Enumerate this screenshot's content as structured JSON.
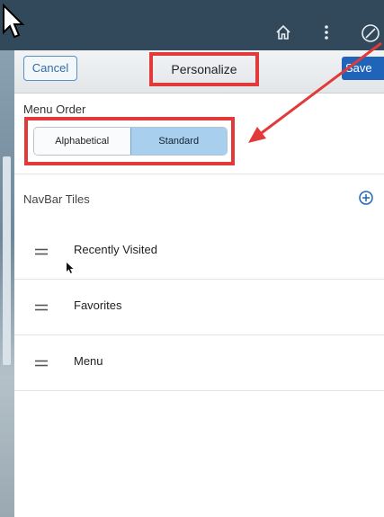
{
  "header": {
    "cancel_label": "Cancel",
    "title": "Personalize",
    "save_label": "Save"
  },
  "menu_order": {
    "label": "Menu Order",
    "options": [
      "Alphabetical",
      "Standard"
    ],
    "selected": "Standard"
  },
  "navbar_tiles": {
    "label": "NavBar Tiles",
    "items": [
      {
        "label": "Recently Visited",
        "icon": "drag-handle-icon"
      },
      {
        "label": "Favorites",
        "icon": "drag-handle-icon"
      },
      {
        "label": "Menu",
        "icon": "drag-handle-icon"
      }
    ]
  },
  "topbar_icons": [
    "home-icon",
    "more-vertical-icon",
    "nav-compass-icon"
  ],
  "colors": {
    "highlight": "#e23a3a",
    "accent": "#1f64b8",
    "selected_segment": "#a8cfee",
    "topbar": "#31495a"
  }
}
